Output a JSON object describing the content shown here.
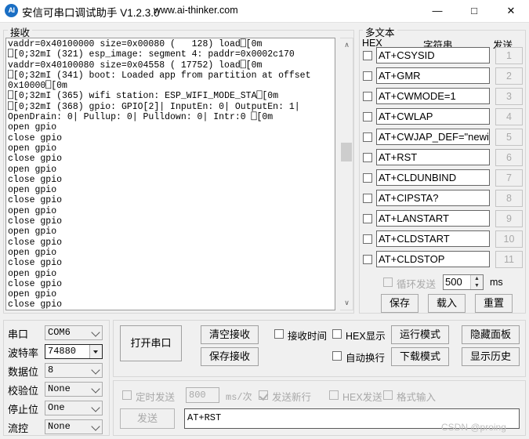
{
  "window": {
    "icon_text": "AI",
    "title": "安信可串口调试助手 V1.2.3.0",
    "url": "www.ai-thinker.com",
    "minimize": "—",
    "maximize": "□",
    "close": "✕"
  },
  "receive": {
    "group_label": "接收",
    "terminal_lines": [
      "vaddr=0x40100000 size=0x00080 (   128) load⎕[0m",
      "⎕[0;32mI (321) esp_image: segment 4: paddr=0x0002c170",
      "vaddr=0x40100080 size=0x04558 ( 17752) load⎕[0m",
      "⎕[0;32mI (341) boot: Loaded app from partition at offset",
      "0x10000⎕[0m",
      "⎕[0;32mI (365) wifi station: ESP_WIFI_MODE_STA⎕[0m",
      "⎕[0;32mI (368) gpio: GPIO[2]| InputEn: 0| OutputEn: 1|",
      "OpenDrain: 0| Pullup: 0| Pulldown: 0| Intr:0 ⎕[0m",
      "open gpio",
      "close gpio",
      "open gpio",
      "close gpio",
      "open gpio",
      "close gpio",
      "open gpio",
      "close gpio",
      "open gpio",
      "close gpio",
      "open gpio",
      "close gpio",
      "open gpio",
      "close gpio",
      "open gpio",
      "close gpio",
      "open gpio",
      "close gpio"
    ],
    "scroll_up": "∧",
    "scroll_down": "∨"
  },
  "multitext": {
    "group_label": "多文本",
    "header_hex": "HEX",
    "header_string": "字符串",
    "header_send": "发送",
    "rows": [
      {
        "hex_checked": false,
        "command": "AT+CSYSID",
        "send_label": "1"
      },
      {
        "hex_checked": false,
        "command": "AT+GMR",
        "send_label": "2"
      },
      {
        "hex_checked": false,
        "command": "AT+CWMODE=1",
        "send_label": "3"
      },
      {
        "hex_checked": false,
        "command": "AT+CWLAP",
        "send_label": "4"
      },
      {
        "hex_checked": false,
        "command": "AT+CWJAP_DEF=\"newifi_",
        "send_label": "5"
      },
      {
        "hex_checked": false,
        "command": "AT+RST",
        "send_label": "6"
      },
      {
        "hex_checked": false,
        "command": "AT+CLDUNBIND",
        "send_label": "7"
      },
      {
        "hex_checked": false,
        "command": "AT+CIPSTA?",
        "send_label": "8"
      },
      {
        "hex_checked": false,
        "command": "AT+LANSTART",
        "send_label": "9"
      },
      {
        "hex_checked": false,
        "command": "AT+CLDSTART",
        "send_label": "10"
      },
      {
        "hex_checked": false,
        "command": "AT+CLDSTOP",
        "send_label": "11"
      }
    ],
    "loop_send_label": "循环发送",
    "loop_interval": "500",
    "loop_unit": "ms",
    "btn_save": "保存",
    "btn_load": "载入",
    "btn_reset": "重置"
  },
  "serial_settings": {
    "fields": [
      {
        "label": "串口",
        "value": "COM6",
        "kind": "combo"
      },
      {
        "label": "波特率",
        "value": "74880",
        "kind": "editcombo"
      },
      {
        "label": "数据位",
        "value": "8",
        "kind": "combo"
      },
      {
        "label": "校验位",
        "value": "None",
        "kind": "combo"
      },
      {
        "label": "停止位",
        "value": "One",
        "kind": "combo"
      },
      {
        "label": "流控",
        "value": "None",
        "kind": "combo"
      }
    ]
  },
  "controls": {
    "open_port": "打开串口",
    "clear_receive": "清空接收",
    "save_receive": "保存接收",
    "recv_time_label": "接收时间",
    "recv_time_checked": false,
    "hex_show_label": "HEX显示",
    "hex_show_checked": false,
    "autowrap_label": "自动换行",
    "autowrap_checked": false,
    "run_mode": "运行模式",
    "download_mode": "下载模式",
    "hide_panel": "隐藏面板",
    "show_history": "显示历史"
  },
  "send_panel": {
    "timed_send_label": "定时发送",
    "timed_send_checked": false,
    "timed_interval": "800",
    "interval_unit": "ms/次",
    "newline_label": "发送新行",
    "newline_checked": true,
    "hex_send_label": "HEX发送",
    "hex_send_checked": false,
    "format_input_label": "格式输入",
    "format_input_checked": false,
    "send_button": "发送",
    "send_value": "AT+RST"
  },
  "watermark": "CSDN @proing"
}
